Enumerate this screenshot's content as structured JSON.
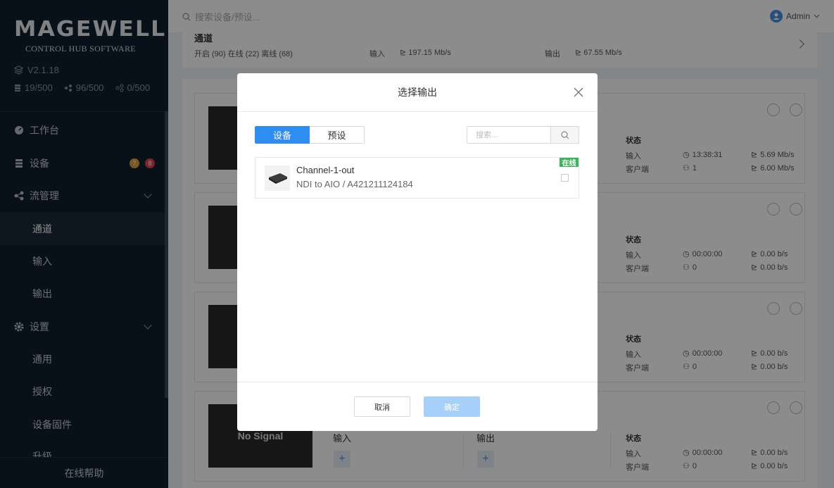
{
  "sidebar": {
    "logo": "MAGEWELL",
    "logo_mark": "®",
    "logo_sub": "CONTROL HUB SOFTWARE",
    "version": "V2.1.18",
    "stats": [
      "19/500",
      "96/500",
      "0/500"
    ],
    "nav": {
      "dashboard": "工作台",
      "devices": "设备",
      "devices_badge_warn": "7",
      "devices_badge_err": "8",
      "stream": "流管理",
      "channels": "通道",
      "inputs": "输入",
      "outputs": "输出",
      "settings": "设置",
      "general": "通用",
      "license": "授权",
      "firmware": "设备固件",
      "upgrade": "升级"
    },
    "help": "在线帮助"
  },
  "topbar": {
    "search_placeholder": "搜索设备/预设...",
    "user": "Admin"
  },
  "summary": {
    "title": "通道",
    "counts": "开启 (90)  在线 (22)  离线 (68)",
    "input_label": "输入",
    "input_rate": "197.15 Mb/s",
    "output_label": "输出",
    "output_rate": "67.55 Mb/s"
  },
  "cards": [
    {
      "time": "13:38:31",
      "rate_in": "5.69 Mb/s",
      "clients": "1",
      "rate_out": "6.00 Mb/s"
    },
    {
      "time": "00:00:00",
      "rate_in": "0.00 b/s",
      "clients": "0",
      "rate_out": "0.00 b/s"
    },
    {
      "time": "00:00:00",
      "rate_in": "0.00 b/s",
      "clients": "0",
      "rate_out": "0.00 b/s"
    },
    {
      "time": "00:00:00",
      "rate_in": "0.00 b/s",
      "clients": "0",
      "rate_out": "0.00 b/s",
      "thumb": "No Signal"
    }
  ],
  "card_labels": {
    "status": "状态",
    "input": "输入",
    "clients": "客户端",
    "io_input": "输入",
    "io_output": "输出",
    "plus": "+"
  },
  "modal": {
    "title": "选择输出",
    "tab_device": "设备",
    "tab_preset": "预设",
    "search_placeholder": "搜索...",
    "device": {
      "name": "Channel-1-out",
      "sub": "NDI to AIO / A421211124184",
      "status": "在线"
    },
    "cancel": "取消",
    "ok": "确定"
  },
  "colors": {
    "sidebar_bg": "#0f1f2e",
    "accent": "#2f8cf0",
    "online": "#3bb55b",
    "badge_warn": "#e2a13a",
    "badge_err": "#e0454b"
  }
}
